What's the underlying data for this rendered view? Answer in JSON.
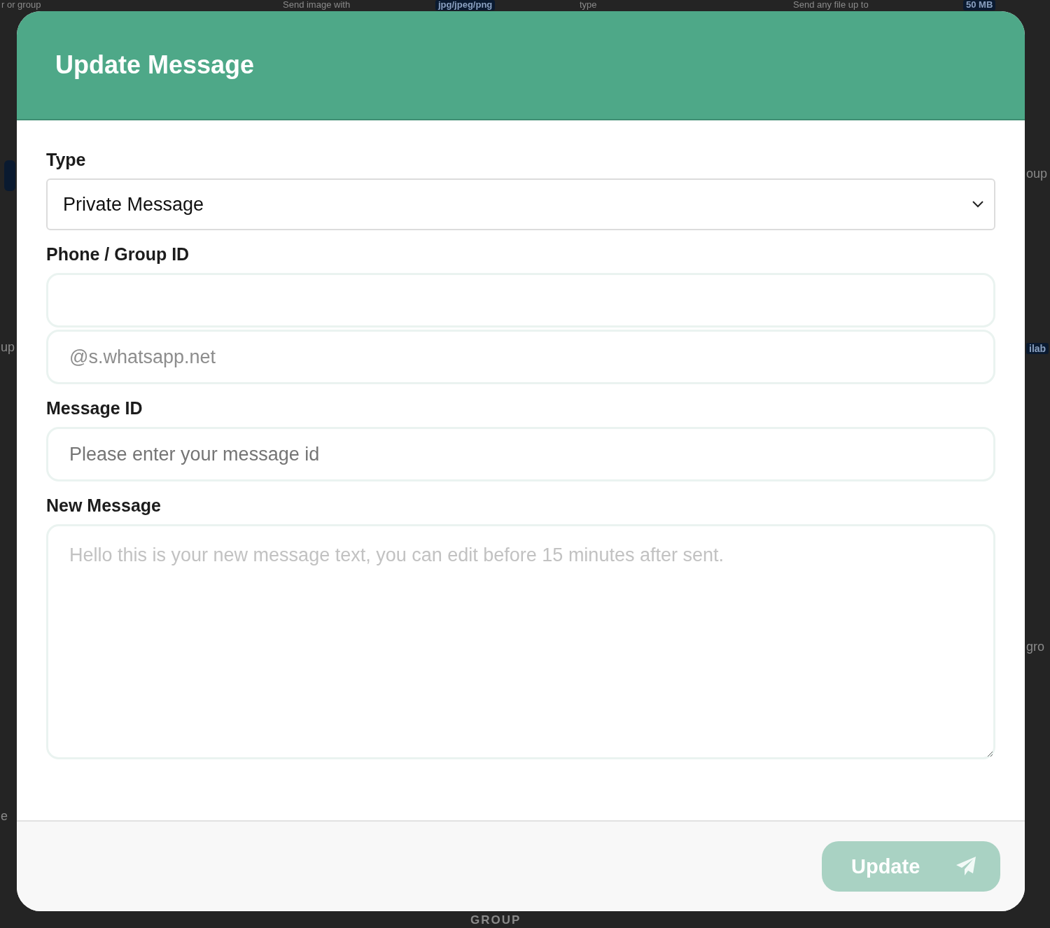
{
  "background": {
    "texts": [
      {
        "text": "r or group",
        "kind": "plain"
      },
      {
        "text": "Send image with",
        "kind": "plain"
      },
      {
        "text": "jpg/jpeg/png",
        "kind": "tag"
      },
      {
        "text": "type",
        "kind": "plain"
      },
      {
        "text": "Send any file up to",
        "kind": "plain"
      },
      {
        "text": "50 MB",
        "kind": "tag"
      },
      {
        "text": "oup",
        "kind": "plain"
      },
      {
        "text": "up",
        "kind": "plain"
      },
      {
        "text": "ilab",
        "kind": "tag"
      },
      {
        "text": "gro",
        "kind": "plain"
      },
      {
        "text": "e",
        "kind": "plain"
      },
      {
        "text": "GROUP",
        "kind": "heading"
      }
    ]
  },
  "dialog": {
    "title": "Update Message",
    "fields": [
      {
        "label": "Type",
        "kind": "select",
        "value": "Private Message"
      },
      {
        "label": "Phone / Group ID",
        "kind": "input",
        "suffix": "@s.whatsapp.net"
      },
      {
        "label": "Message ID",
        "kind": "input",
        "placeholder": "Please enter your message id"
      },
      {
        "label": "New Message",
        "kind": "textarea",
        "placeholder": "Hello this is your new message text, you can edit before 15 minutes after sent."
      }
    ],
    "button": {
      "label": "Update",
      "disabled": true
    }
  }
}
